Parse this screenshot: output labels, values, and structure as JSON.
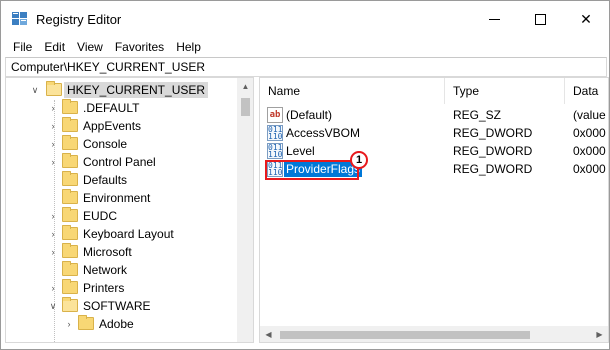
{
  "window": {
    "title": "Registry Editor",
    "minimize_icon": "minimize-icon",
    "maximize_icon": "maximize-icon",
    "close_label": "✕"
  },
  "menu": [
    "File",
    "Edit",
    "View",
    "Favorites",
    "Help"
  ],
  "address": "Computer\\HKEY_CURRENT_USER",
  "tree": {
    "root": "HKEY_CURRENT_USER",
    "items": [
      ".DEFAULT",
      "AppEvents",
      "Console",
      "Control Panel",
      "Defaults",
      "Environment",
      "EUDC",
      "Keyboard Layout",
      "Microsoft",
      "Network",
      "Printers",
      "SOFTWARE",
      "Adobe"
    ]
  },
  "values": {
    "headers": {
      "name": "Name",
      "type": "Type",
      "data": "Data"
    },
    "rows": [
      {
        "name": "(Default)",
        "type": "REG_SZ",
        "data": "(value",
        "icon": "string-value-icon",
        "icon_text": "ab"
      },
      {
        "name": "AccessVBOM",
        "type": "REG_DWORD",
        "data": "0x000",
        "icon": "dword-value-icon",
        "icon_text": "011 110"
      },
      {
        "name": "Level",
        "type": "REG_DWORD",
        "data": "0x000",
        "icon": "dword-value-icon",
        "icon_text": "011 110"
      },
      {
        "name": "ProviderFlags",
        "type": "REG_DWORD",
        "data": "0x000",
        "icon": "dword-value-icon",
        "icon_text": "011 110"
      }
    ],
    "step_badge": "1"
  },
  "colors": {
    "selection": "#0078d7",
    "annotation": "#e8191c",
    "folder": "#f8d775"
  }
}
